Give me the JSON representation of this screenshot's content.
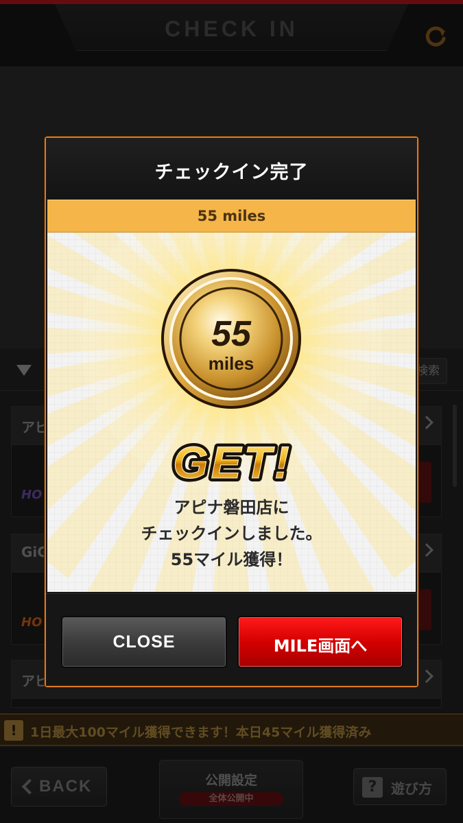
{
  "header": {
    "title": "CHECK IN",
    "refresh_icon": "refresh-icon"
  },
  "list": {
    "search_label": "検索",
    "stores": [
      {
        "name": "アピ",
        "logo": "HO",
        "logo_color": "#6a4aa8"
      },
      {
        "name": "GiG",
        "logo": "HO",
        "logo_color": "#c85a10"
      },
      {
        "name": "アピ"
      }
    ]
  },
  "notice": {
    "icon": "!",
    "text": "1日最大100マイル獲得できます！本日45マイル獲得済み"
  },
  "bottom": {
    "back_label": "BACK",
    "public_label": "公開設定",
    "public_badge": "全体公開中",
    "howto_icon": "?",
    "howto_label": "遊び方"
  },
  "modal": {
    "title": "チェックイン完了",
    "banner": "55 miles",
    "coin_number": "55",
    "coin_unit": "miles",
    "get_text": "GET!",
    "message_lines": [
      "アピナ磐田店に",
      "チェックインしました。",
      "55マイル獲得！"
    ],
    "close_label": "CLOSE",
    "mile_label": "MILE画面へ"
  },
  "colors": {
    "accent_orange": "#e07a22",
    "banner": "#f5b548",
    "primary_red": "#d40000",
    "gold": "#e0b24a"
  }
}
